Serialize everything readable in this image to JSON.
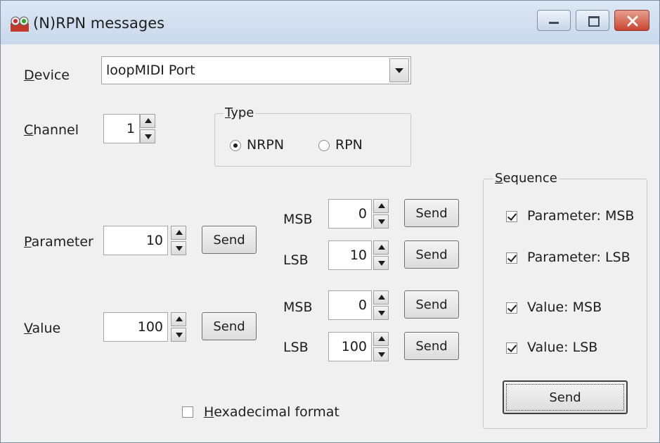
{
  "window": {
    "title": "(N)RPN messages"
  },
  "device": {
    "label_accel": "D",
    "label_rest": "evice",
    "value": "loopMIDI Port"
  },
  "channel": {
    "label_accel": "C",
    "label_rest": "hannel",
    "value": "1"
  },
  "type": {
    "legend_accel": "T",
    "legend_rest": "ype",
    "options": [
      {
        "label": "NRPN",
        "selected": true
      },
      {
        "label": "RPN",
        "selected": false
      }
    ]
  },
  "parameter": {
    "label_accel": "P",
    "label_rest": "arameter",
    "value": "10",
    "send_label": "Send",
    "msb": {
      "label": "MSB",
      "value": "0",
      "send_label": "Send"
    },
    "lsb": {
      "label": "LSB",
      "value": "10",
      "send_label": "Send"
    }
  },
  "value": {
    "label_accel": "V",
    "label_rest": "alue",
    "value": "100",
    "send_label": "Send",
    "msb": {
      "label": "MSB",
      "value": "0",
      "send_label": "Send"
    },
    "lsb": {
      "label": "LSB",
      "value": "100",
      "send_label": "Send"
    }
  },
  "hex_format": {
    "label_accel": "H",
    "label_rest": "exadecimal format",
    "checked": false
  },
  "sequence": {
    "legend_accel": "S",
    "legend_rest": "equence",
    "items": [
      {
        "label": "Parameter: MSB",
        "checked": true
      },
      {
        "label": "Parameter: LSB",
        "checked": true
      },
      {
        "label": "Value: MSB",
        "checked": true
      },
      {
        "label": "Value: LSB",
        "checked": true
      }
    ],
    "send_label": "Send"
  }
}
